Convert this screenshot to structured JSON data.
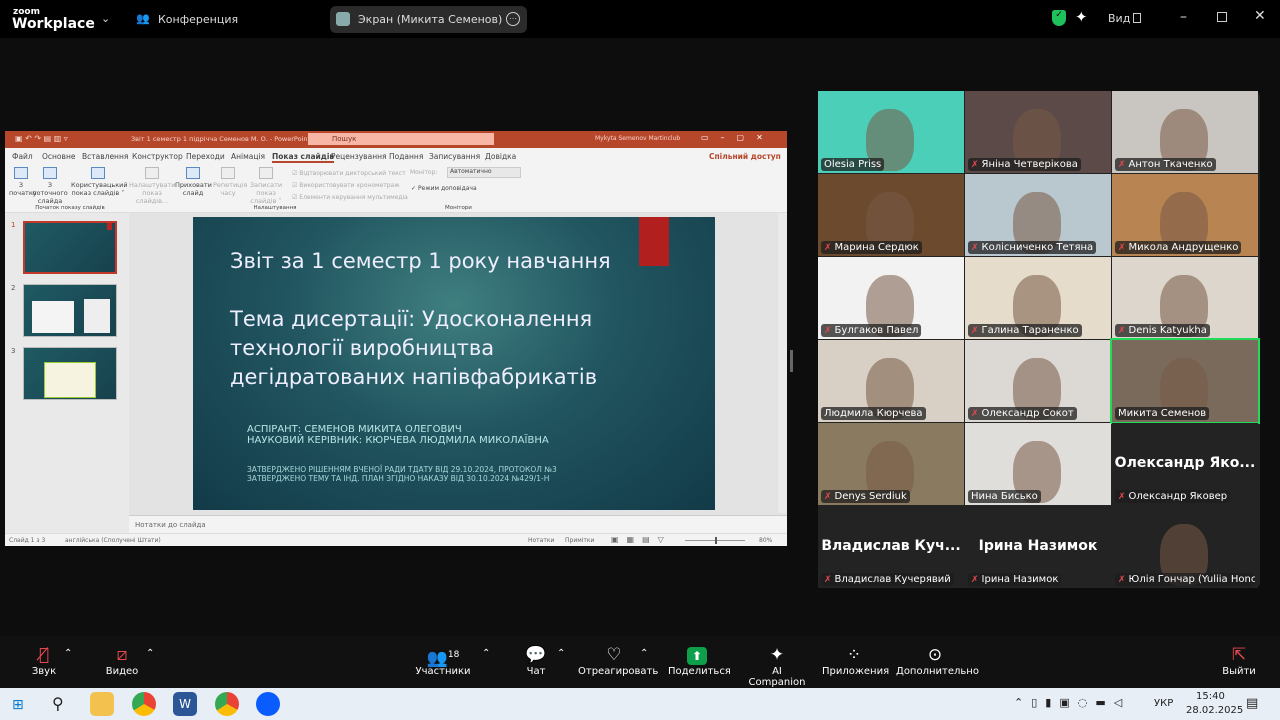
{
  "topbar": {
    "logo_small": "zoom",
    "logo_big": "Workplace",
    "meeting_label": "Конференция",
    "screen_share_label": "Экран (Микита Семенов)",
    "view_label": "Вид"
  },
  "ppt": {
    "title": "Звіт 1 семестр 1 підрічча Семенов М. О. - PowerPoint",
    "search_placeholder": "Пошук",
    "user": "Mykyta Semenov Martinclub",
    "share": "Спільний доступ",
    "tabs": [
      "Файл",
      "Основне",
      "Вставлення",
      "Конструктор",
      "Переходи",
      "Анімація",
      "Показ слайдів",
      "Рецензування",
      "Подання",
      "Записування",
      "Довідка"
    ],
    "active_tab": "Показ слайдів",
    "ribbon": {
      "from_start": "З початку",
      "from_current": "З поточного слайда",
      "custom": "Користувацький показ слайдів ˅",
      "setup": "Налаштувати показ слайдів...",
      "hide": "Приховати слайд",
      "rehearse": "Репетиція часу",
      "record": "Записати показ слайдів ˅",
      "cb1": "Відтворювати дикторський текст",
      "cb2": "Використовувати хронометраж",
      "cb3": "Елементи керування мультимедіа",
      "monitor": "Монітор:",
      "monitor_value": "Автоматично",
      "presenter": "Режим доповідача",
      "group1": "Початок показу слайдів",
      "group2": "Налаштування",
      "group3": "Монітори"
    },
    "thumb_numbers": [
      "1",
      "2",
      "3"
    ],
    "slide": {
      "title": "Звіт за 1 семестр 1 року навчання",
      "topic": "Тема дисертації: Удосконалення технології виробництва дегідратованих напівфабрикатів",
      "line1": "АСПІРАНТ: СЕМЕНОВ МИКИТА ОЛЕГОВИЧ",
      "line2": "НАУКОВИЙ КЕРІВНИК: КЮРЧЕВА ЛЮДМИЛА МИКОЛАЇВНА",
      "line3": "ЗАТВЕРДЖЕНО РІШЕННЯМ ВЧЕНОЇ РАДИ ТДАТУ ВІД 29.10.2024, ПРОТОКОЛ №3",
      "line4": "ЗАТВЕРДЖЕНО ТЕМУ ТА ІНД. ПЛАН ЗГІДНО НАКАЗУ ВІД 30.10.2024 №429/1-Н"
    },
    "notes_placeholder": "Нотатки до слайда",
    "status": {
      "slide": "Слайд 1 з 3",
      "language": "англійська (Сполучені Штати)",
      "notes": "Нотатки",
      "comments": "Примітки",
      "zoom": "80%"
    }
  },
  "participants": [
    {
      "name": "Olesia Priss",
      "muted": false,
      "bg": "#4ccfb8"
    },
    {
      "name": "Яніна Четверікова",
      "muted": true,
      "bg": "#5b4a48"
    },
    {
      "name": "Антон Ткаченко",
      "muted": true,
      "bg": "#c9c6c1"
    },
    {
      "name": "Марина Сердюк",
      "muted": true,
      "bg": "#6b4a2e"
    },
    {
      "name": "Колісниченко Тетяна",
      "muted": true,
      "bg": "#b9c7cf"
    },
    {
      "name": "Микола Андрущенко",
      "muted": true,
      "bg": "#b88452"
    },
    {
      "name": "Булгаков Павел",
      "muted": true,
      "bg": "#f2f2f2"
    },
    {
      "name": "Галина Тараненко",
      "muted": true,
      "bg": "#e5dccb"
    },
    {
      "name": "Denis Katyukha",
      "muted": true,
      "bg": "#dcd6cc"
    },
    {
      "name": "Людмила Кюрчева",
      "muted": false,
      "bg": "#d8d0c4"
    },
    {
      "name": "Олександр Сокот",
      "muted": true,
      "bg": "#dcd8d4"
    },
    {
      "name": "Микита Семенов",
      "muted": false,
      "bg": "#7a6a5c",
      "active": true
    },
    {
      "name": "Denys Serdiuk",
      "muted": true,
      "bg": "#8a7a60"
    },
    {
      "name": "Нина Бисько",
      "muted": false,
      "bg": "#e0dedb"
    },
    {
      "name": "Олександр Яковер",
      "muted": true,
      "bg": "#232323",
      "big": "Олександр Яко..."
    },
    {
      "name": "Владислав Кучерявий",
      "muted": true,
      "bg": "#232323",
      "big": "Владислав Куч..."
    },
    {
      "name": "Ірина Назимок",
      "muted": true,
      "bg": "#232323",
      "big": "Ірина Назимок"
    },
    {
      "name": "Юлія Гончар (Yuliia Honc...",
      "muted": true,
      "bg": "#232323"
    }
  ],
  "toolbar": {
    "audio": "Звук",
    "video": "Видео",
    "participants": "Участники",
    "participants_count": "18",
    "chat": "Чат",
    "react": "Отреагировать",
    "share": "Поделиться",
    "ai": "AI Companion",
    "apps": "Приложения",
    "more": "Дополнительно",
    "leave": "Выйти"
  },
  "taskbar": {
    "lang": "УКР",
    "time": "15:40",
    "date": "28.02.2025"
  },
  "colors": {
    "ppt_accent": "#b7472a",
    "active_speaker": "#23d959",
    "share_green": "#0e9f4a",
    "mute_red": "#e5484d"
  }
}
